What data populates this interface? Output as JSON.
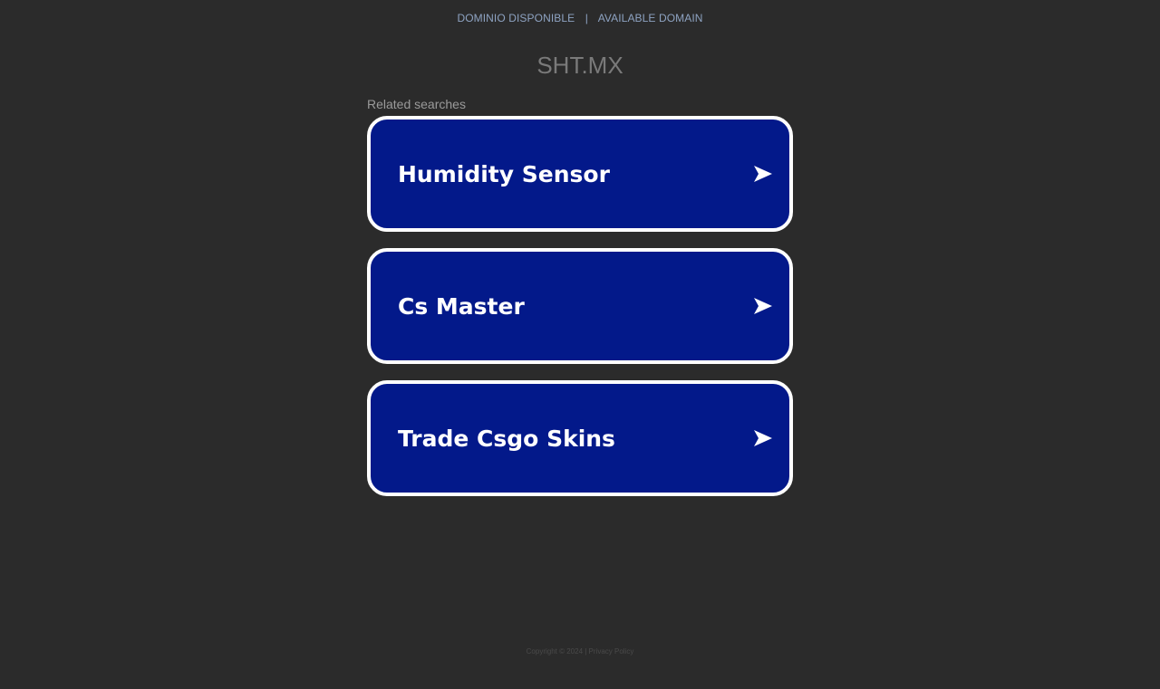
{
  "topbar": {
    "left_link": "DOMINIO DISPONIBLE",
    "separator": "|",
    "right_link": "AVAILABLE DOMAIN",
    "link_color": "#8ea3c2"
  },
  "domain": {
    "title": "SHT.MX"
  },
  "related": {
    "label": "Related searches",
    "items": [
      {
        "label": "Humidity Sensor",
        "icon": "arrow-right-icon"
      },
      {
        "label": "Cs Master",
        "icon": "arrow-right-icon"
      },
      {
        "label": "Trade Csgo Skins",
        "icon": "arrow-right-icon"
      }
    ]
  },
  "footer": {
    "text": "Copyright © 2024 | Privacy Policy"
  },
  "colors": {
    "background": "#2b2b2b",
    "card": "#03198a",
    "card_border": "#ffffff",
    "title": "#7a7a7a"
  }
}
